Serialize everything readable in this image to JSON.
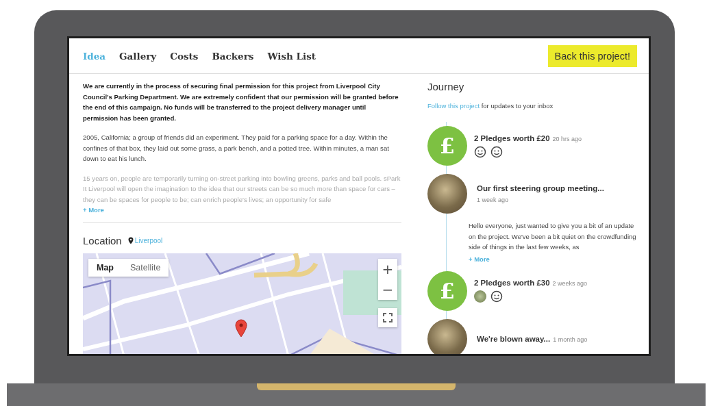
{
  "tabs": [
    {
      "label": "Idea",
      "selected": true
    },
    {
      "label": "Gallery",
      "selected": false
    },
    {
      "label": "Costs",
      "selected": false
    },
    {
      "label": "Backers",
      "selected": false
    },
    {
      "label": "Wish List",
      "selected": false
    }
  ],
  "back_button": "Back this project!",
  "idea": {
    "paragraphs": [
      {
        "text": "We are currently in the process of securing final permission for this project from Liverpool City Council's Parking Department. We are extremely confident that our permission will be granted before the end of this campaign. No funds will be transferred to the project delivery manager until permission has been granted.",
        "bold": true
      },
      {
        "text": "2005, California; a group of friends did an experiment. They paid for a parking space for a day. Within the confines of that box, they laid out some grass, a park bench, and a potted tree. Within minutes, a man sat down to eat his lunch.",
        "bold": false
      },
      {
        "text": "15 years on, people are temporarily turning on-street parking into bowling greens, parks and ball pools. sPark It Liverpool will open the imagination to the idea that our streets can be so much more than space for cars – they can be spaces for people to be; can enrich people's lives; an opportunity for safe",
        "bold": false
      }
    ],
    "more": "+ More"
  },
  "location": {
    "heading": "Location",
    "place": "Liverpool",
    "map_modes": [
      {
        "label": "Map",
        "selected": true
      },
      {
        "label": "Satellite",
        "selected": false
      }
    ],
    "zoom_in": "+",
    "zoom_out": "−"
  },
  "journey": {
    "heading": "Journey",
    "follow_link": "Follow this project",
    "follow_text": "for updates to your inbox",
    "entries": [
      {
        "kind": "pledge",
        "symbol": "£",
        "title": "2 Pledges worth £20",
        "time": "20 hrs ago",
        "backers": [
          {
            "kind": "face"
          },
          {
            "kind": "face"
          }
        ]
      },
      {
        "kind": "update",
        "title": "Our first steering group meeting...",
        "time": "1 week ago",
        "body": "Hello everyone, just wanted to give you a bit of an update on the project. We've been a bit quiet on the crowdfunding side of things in the last few weeks, as",
        "more": "+ More"
      },
      {
        "kind": "pledge",
        "symbol": "£",
        "title": "2 Pledges worth £30",
        "time": "2 weeks ago",
        "backers": [
          {
            "kind": "photo"
          },
          {
            "kind": "face"
          }
        ]
      },
      {
        "kind": "update",
        "title": "We're blown away...",
        "time": "1 month ago"
      }
    ]
  }
}
